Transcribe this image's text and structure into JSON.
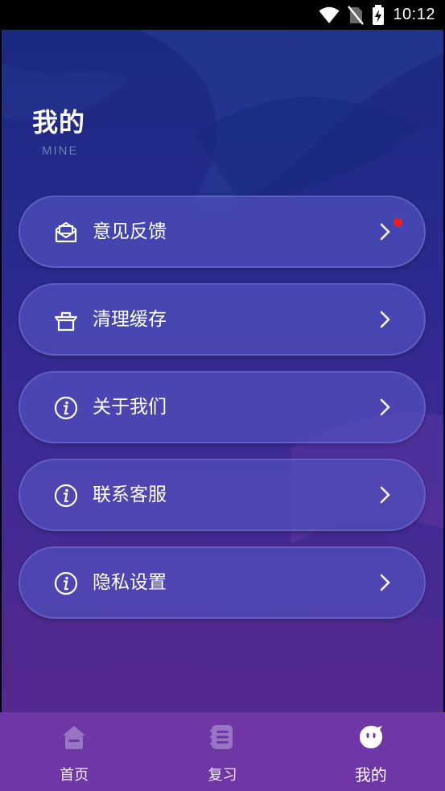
{
  "status_bar": {
    "time": "10:12"
  },
  "page": {
    "title": "我的",
    "subtitle": "MINE"
  },
  "menu": [
    {
      "label": "意见反馈",
      "icon": "mail-icon",
      "badge": true
    },
    {
      "label": "清理缓存",
      "icon": "basket-icon",
      "badge": false
    },
    {
      "label": "关于我们",
      "icon": "info-icon",
      "badge": false
    },
    {
      "label": "联系客服",
      "icon": "info-icon",
      "badge": false
    },
    {
      "label": "隐私设置",
      "icon": "info-icon",
      "badge": false
    }
  ],
  "tabs": [
    {
      "label": "首页",
      "icon": "home-icon",
      "active": false
    },
    {
      "label": "复习",
      "icon": "list-icon",
      "active": false
    },
    {
      "label": "我的",
      "icon": "profile-face-icon",
      "active": true
    }
  ],
  "colors": {
    "badge": "#ff1a1a",
    "tab_bar": "#6f36a6",
    "menu_item": "#5050be"
  }
}
